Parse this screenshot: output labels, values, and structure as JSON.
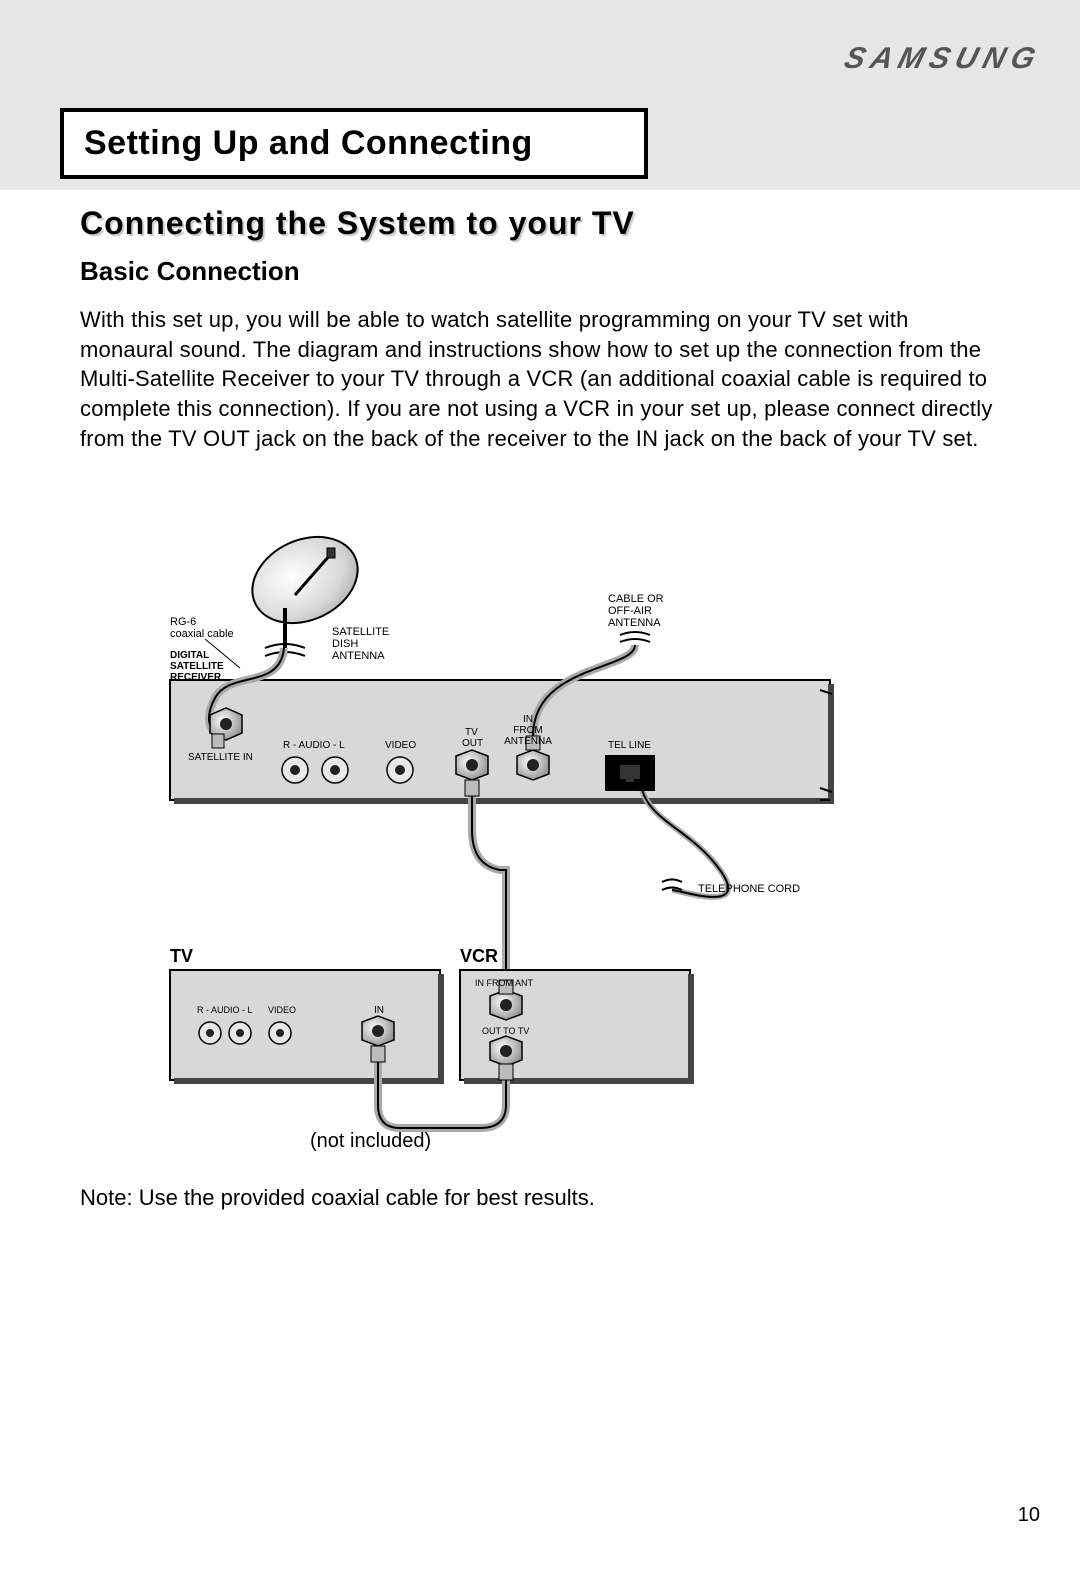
{
  "brand": "SAMSUNG",
  "page_number": "10",
  "section_title": "Setting Up and Connecting",
  "subtitle": "Connecting the System to your TV",
  "subsection": "Basic Connection",
  "body_text": "With this set up, you will be able to watch satellite programming on your TV set with monaural sound. The diagram and instructions show how to set up the connection from the Multi-Satellite Receiver to your TV through a VCR (an additional coaxial cable is required to complete this connection). If you are not using a VCR in your set up, please connect directly from the TV OUT jack on the back of the receiver to the IN jack on the back of your TV set.",
  "diagram": {
    "rg6_label1": "RG-6",
    "rg6_label2": "coaxial cable",
    "dish_label1": "SATELLITE",
    "dish_label2": "DISH",
    "dish_label3": "ANTENNA",
    "receiver_label1": "DIGITAL",
    "receiver_label2": "SATELLITE",
    "receiver_label3": "RECEIVER",
    "cable_label1": "CABLE OR",
    "cable_label2": "OFF-AIR",
    "cable_label3": "ANTENNA",
    "sat_in": "SATELLITE IN",
    "r_audio_l": "R - AUDIO - L",
    "video": "VIDEO",
    "tv_out1": "TV",
    "tv_out2": "OUT",
    "in_from1": "IN",
    "in_from2": "FROM",
    "in_from3": "ANTENNA",
    "tel_line": "TEL LINE",
    "telephone_cord": "TELEPHONE CORD",
    "tv": "TV",
    "vcr": "VCR",
    "in": "IN",
    "in_from_ant": "IN FROM  ANT",
    "out_to_tv": "OUT TO TV"
  },
  "not_included": "(not included)",
  "note": "Note: Use the provided coaxial cable for best results."
}
